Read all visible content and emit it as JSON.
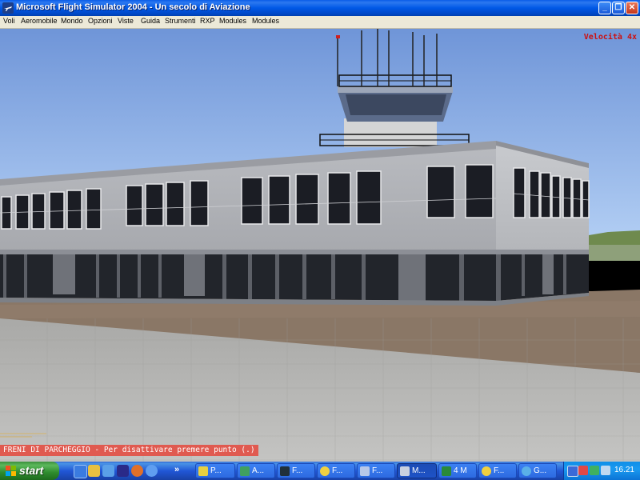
{
  "window": {
    "title": "Microsoft Flight Simulator 2004 - Un secolo di Aviazione",
    "minimize_label": "_",
    "maximize_label": "❐",
    "close_label": "✕"
  },
  "menu": [
    "Voli",
    "Aeromobile",
    "Mondo",
    "Opzioni",
    "Viste",
    "Guida",
    "Strumenti",
    "RXP",
    "Modules",
    "Modules"
  ],
  "scene": {
    "speed_indicator": "Velocità 4x",
    "status_message": "FRENI DI PARCHEGGIO - Per disattivare premere punto (.)"
  },
  "taskbar": {
    "start_label": "start",
    "quick_launch_icons": [
      "ie-icon",
      "outlook-icon",
      "desktop-icon",
      "media-icon",
      "firefox-icon",
      "search-icon"
    ],
    "overflow_label": "»",
    "buttons": [
      {
        "label": "P...",
        "icon": "paint-icon"
      },
      {
        "label": "A...",
        "icon": "plane-icon"
      },
      {
        "label": "F...",
        "icon": "folder-icon"
      },
      {
        "label": "F...",
        "icon": "folder-icon"
      },
      {
        "label": "F...",
        "icon": "plane-icon"
      },
      {
        "label": "M...",
        "icon": "fs-icon"
      },
      {
        "label": "4 M",
        "icon": "excel-icon"
      },
      {
        "label": "F...",
        "icon": "folder-icon"
      },
      {
        "label": "G...",
        "icon": "chat-icon"
      }
    ],
    "clock": "16.21"
  },
  "colors": {
    "sky_top": "#6f95d8",
    "sky_bottom": "#a9c8f2",
    "speed_text": "#cc1010",
    "status_bg": "#e05a50",
    "taskbar_blue": "#2157d7",
    "start_green": "#3c8f3c"
  }
}
